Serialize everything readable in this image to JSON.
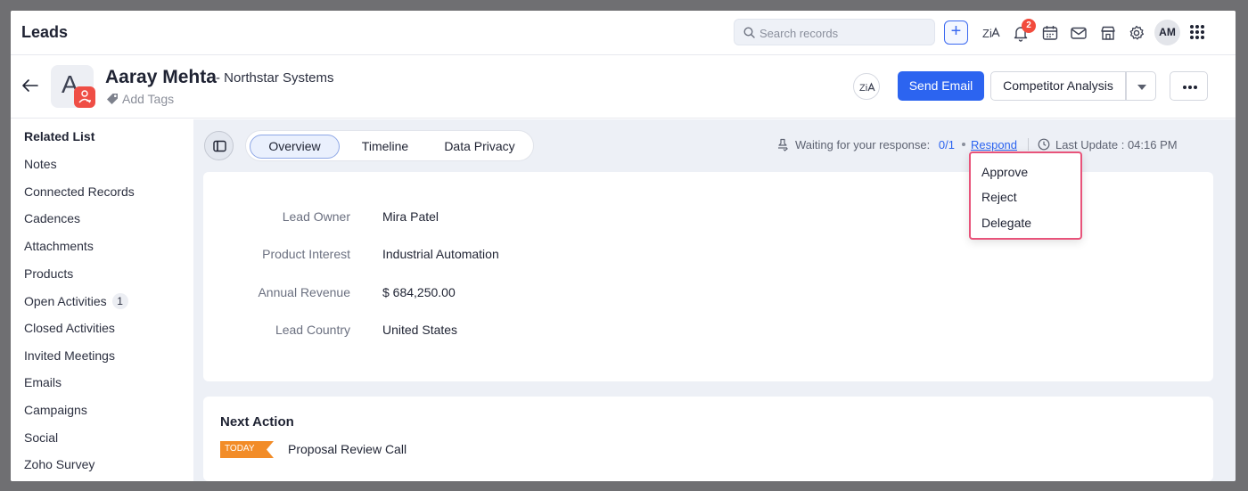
{
  "app": {
    "title": "Leads"
  },
  "topbar": {
    "search_placeholder": "Search records",
    "notification_count": "2",
    "avatar_initials": "AM",
    "icons": [
      "search-icon",
      "plus-icon",
      "zia-icon",
      "bell-icon",
      "calendar-icon",
      "mail-icon",
      "marketplace-icon",
      "gear-icon",
      "apps-grid-icon"
    ]
  },
  "record": {
    "avatar_letter": "A",
    "name": "Aaray Mehta",
    "company": "- Northstar Systems",
    "add_tags": "Add Tags",
    "send_email": "Send Email",
    "competitor_analysis": "Competitor Analysis"
  },
  "sidebar": {
    "heading": "Related List",
    "items": [
      {
        "label": "Notes",
        "count": ""
      },
      {
        "label": "Connected Records",
        "count": ""
      },
      {
        "label": "Cadences",
        "count": ""
      },
      {
        "label": "Attachments",
        "count": ""
      },
      {
        "label": "Products",
        "count": ""
      },
      {
        "label": "Open Activities",
        "count": "1"
      },
      {
        "label": "Closed Activities",
        "count": ""
      },
      {
        "label": "Invited Meetings",
        "count": ""
      },
      {
        "label": "Emails",
        "count": ""
      },
      {
        "label": "Campaigns",
        "count": ""
      },
      {
        "label": "Social",
        "count": ""
      },
      {
        "label": "Zoho Survey",
        "count": ""
      }
    ]
  },
  "tabs": [
    {
      "label": "Overview",
      "active": true
    },
    {
      "label": "Timeline",
      "active": false
    },
    {
      "label": "Data Privacy",
      "active": false
    }
  ],
  "approval": {
    "waiting_text": "Waiting for your response:",
    "ratio": "0/1",
    "respond": "Respond",
    "last_update": "Last Update : 04:16 PM"
  },
  "respond_menu": {
    "items": [
      "Approve",
      "Reject",
      "Delegate"
    ]
  },
  "fields": [
    {
      "label": "Lead Owner",
      "value": "Mira Patel"
    },
    {
      "label": "Product Interest",
      "value": "Industrial Automation"
    },
    {
      "label": "Annual Revenue",
      "value": "$ 684,250.00"
    },
    {
      "label": "Lead Country",
      "value": "United States"
    }
  ],
  "next_action": {
    "title": "Next Action",
    "tag": "TODAY",
    "text": "Proposal Review Call"
  },
  "colors": {
    "primary": "#2c64f0",
    "badge": "#f24b3d",
    "menu_border": "#e8537a",
    "today_tag": "#f28c28"
  }
}
